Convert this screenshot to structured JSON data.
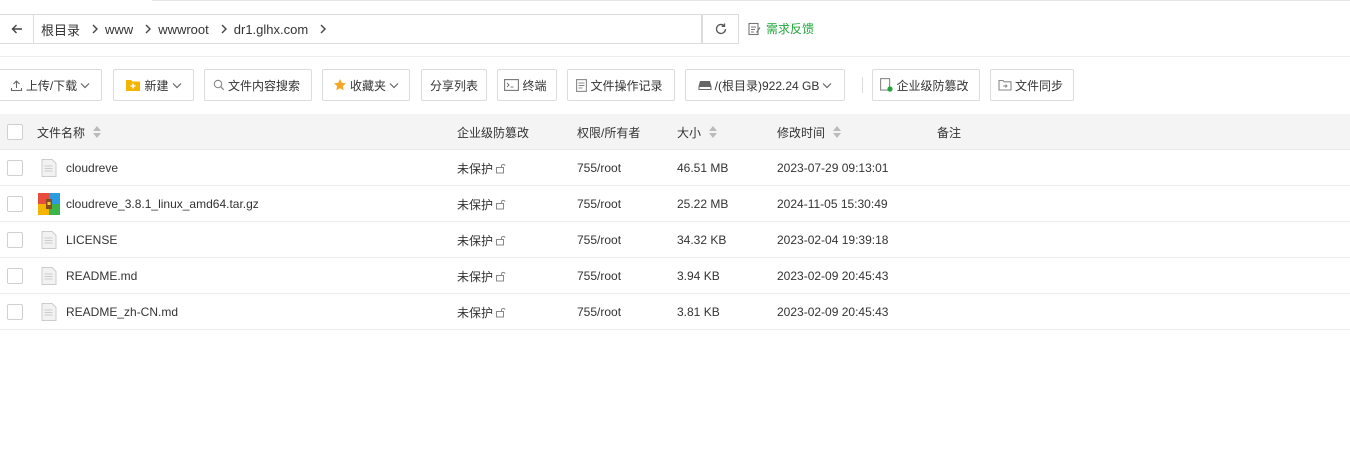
{
  "path_bar": {
    "crumbs": [
      "根目录",
      "www",
      "wwwroot",
      "dr1.glhx.com"
    ],
    "feedback_label": "需求反馈"
  },
  "toolbar": {
    "upload_label": "上传/下载",
    "new_label": "新建",
    "search_content_label": "文件内容搜索",
    "favorites_label": "收藏夹",
    "share_list_label": "分享列表",
    "terminal_label": "终端",
    "operation_log_label": "文件操作记录",
    "disk_label": "/(根目录)922.24 GB",
    "tamper_label": "企业级防篡改",
    "sync_label": "文件同步"
  },
  "table": {
    "headers": {
      "name": "文件名称",
      "tamper": "企业级防篡改",
      "perm": "权限/所有者",
      "size": "大小",
      "mtime": "修改时间",
      "note": "备注"
    },
    "rows": [
      {
        "name": "cloudreve",
        "icon": "file-icon",
        "tamper": "未保护",
        "perm": "755/root",
        "size": "46.51 MB",
        "mtime": "2023-07-29 09:13:01",
        "note": ""
      },
      {
        "name": "cloudreve_3.8.1_linux_amd64.tar.gz",
        "icon": "archive-icon",
        "tamper": "未保护",
        "perm": "755/root",
        "size": "25.22 MB",
        "mtime": "2024-11-05 15:30:49",
        "note": ""
      },
      {
        "name": "LICENSE",
        "icon": "file-icon",
        "tamper": "未保护",
        "perm": "755/root",
        "size": "34.32 KB",
        "mtime": "2023-02-04 19:39:18",
        "note": ""
      },
      {
        "name": "README.md",
        "icon": "file-icon",
        "tamper": "未保护",
        "perm": "755/root",
        "size": "3.94 KB",
        "mtime": "2023-02-09 20:45:43",
        "note": ""
      },
      {
        "name": "README_zh-CN.md",
        "icon": "file-icon",
        "tamper": "未保护",
        "perm": "755/root",
        "size": "3.81 KB",
        "mtime": "2023-02-09 20:45:43",
        "note": ""
      }
    ]
  },
  "colors": {
    "accent_green": "#20a53a",
    "folder_yellow": "#f5b400",
    "star_yellow": "#f5a623"
  }
}
